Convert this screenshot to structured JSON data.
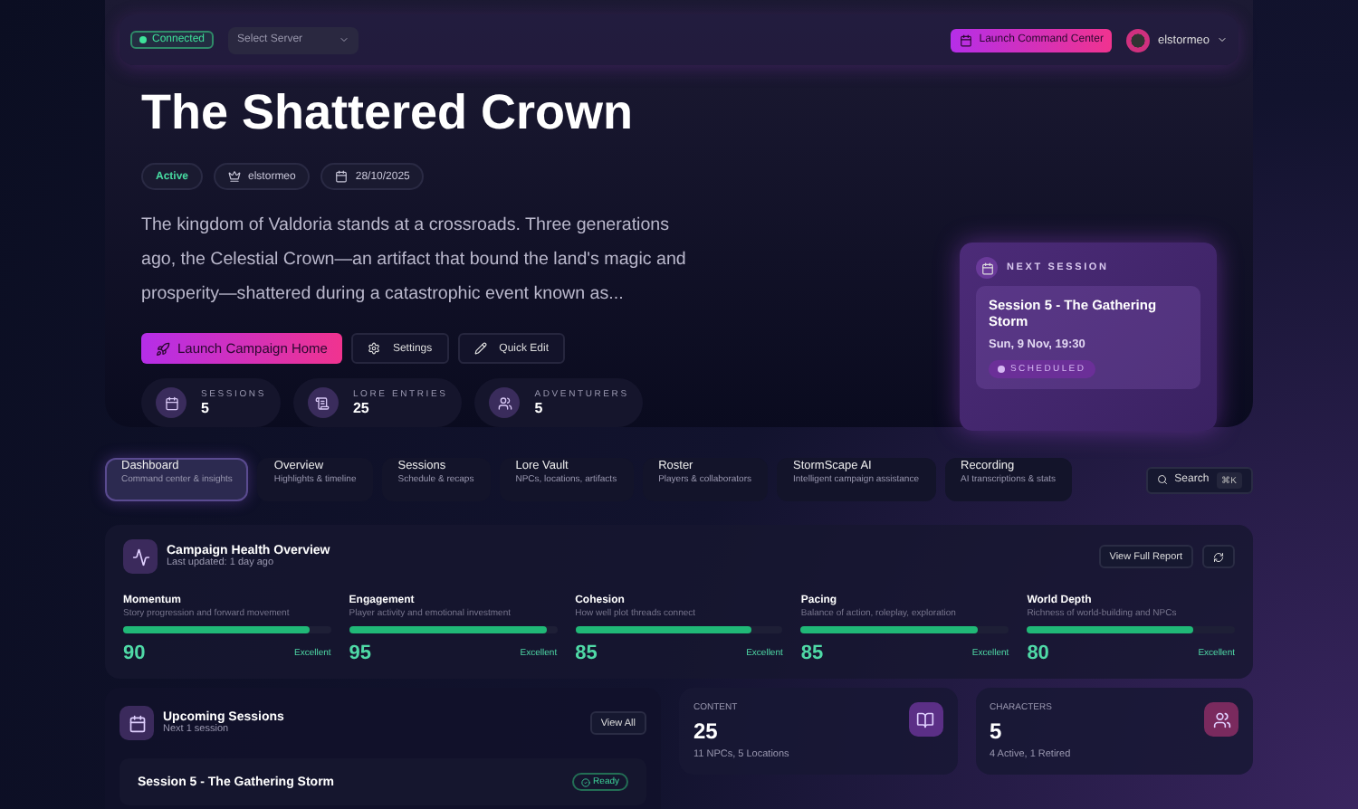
{
  "topbar": {
    "connection": {
      "label": "Connected",
      "connected": true
    },
    "server_select": {
      "placeholder": "Select Server"
    },
    "launch_button": "Launch Command Center",
    "user": {
      "name": "elstormeo"
    }
  },
  "hero": {
    "title": "The Shattered Crown",
    "chips": [
      {
        "kind": "status",
        "label": "Active"
      },
      {
        "kind": "owner",
        "label": "elstormeo"
      },
      {
        "kind": "date",
        "label": "28/10/2025"
      }
    ],
    "description": "The kingdom of Valdoria stands at a crossroads. Three generations ago, the Celestial Crown—an artifact that bound the land's magic and prosperity—shattered during a catastrophic event known as...",
    "actions": [
      {
        "kind": "primary",
        "label": "Launch Campaign Home"
      },
      {
        "kind": "settings",
        "label": "Settings"
      },
      {
        "kind": "edit",
        "label": "Quick Edit"
      }
    ],
    "stats": [
      {
        "kind": "sessions",
        "label": "SESSIONS",
        "value": "5"
      },
      {
        "kind": "lore",
        "label": "LORE ENTRIES",
        "value": "25"
      },
      {
        "kind": "adventurers",
        "label": "ADVENTURERS",
        "value": "5"
      }
    ],
    "next_session": {
      "heading": "NEXT SESSION",
      "title": "Session 5 - The Gathering Storm",
      "when": "Sun, 9 Nov, 19:30",
      "status": "SCHEDULED"
    }
  },
  "tabs": [
    {
      "label": "Dashboard",
      "sub": "Command center & insights",
      "selected": true
    },
    {
      "label": "Overview",
      "sub": "Highlights & timeline",
      "selected": false
    },
    {
      "label": "Sessions",
      "sub": "Schedule & recaps",
      "selected": false
    },
    {
      "label": "Lore Vault",
      "sub": "NPCs, locations, artifacts",
      "selected": false
    },
    {
      "label": "Roster",
      "sub": "Players & collaborators",
      "selected": false
    },
    {
      "label": "StormScape AI",
      "sub": "Intelligent campaign assistance",
      "selected": false
    },
    {
      "label": "Recording",
      "sub": "AI transcriptions & stats",
      "selected": false
    }
  ],
  "search": {
    "label": "Search",
    "shortcut": "⌘K"
  },
  "health": {
    "title": "Campaign Health Overview",
    "updated": "Last updated: 1 day ago",
    "report_button": "View Full Report",
    "metrics": [
      {
        "name": "Momentum",
        "desc": "Story progression and forward movement",
        "level": 0.9,
        "score": "90",
        "rating": "Excellent"
      },
      {
        "name": "Engagement",
        "desc": "Player activity and emotional investment",
        "level": 0.95,
        "score": "95",
        "rating": "Excellent"
      },
      {
        "name": "Cohesion",
        "desc": "How well plot threads connect",
        "level": 0.85,
        "score": "85",
        "rating": "Excellent"
      },
      {
        "name": "Pacing",
        "desc": "Balance of action, roleplay, exploration",
        "level": 0.85,
        "score": "85",
        "rating": "Excellent"
      },
      {
        "name": "World Depth",
        "desc": "Richness of world-building and NPCs",
        "level": 0.8,
        "score": "80",
        "rating": "Excellent"
      }
    ]
  },
  "upcoming": {
    "title": "Upcoming Sessions",
    "subtitle": "Next 1 session",
    "view_all": "View All",
    "sessions": [
      {
        "title": "Session 5 - The Gathering Storm",
        "status": "Ready"
      }
    ]
  },
  "summary_cards": [
    {
      "kind": "content",
      "label": "CONTENT",
      "value": "25",
      "detail": "11 NPCs, 5 Locations",
      "color": "#5b2f86"
    },
    {
      "kind": "characters",
      "label": "CHARACTERS",
      "value": "5",
      "detail": "4 Active, 1 Retired",
      "color": "#7a2a5e"
    }
  ]
}
